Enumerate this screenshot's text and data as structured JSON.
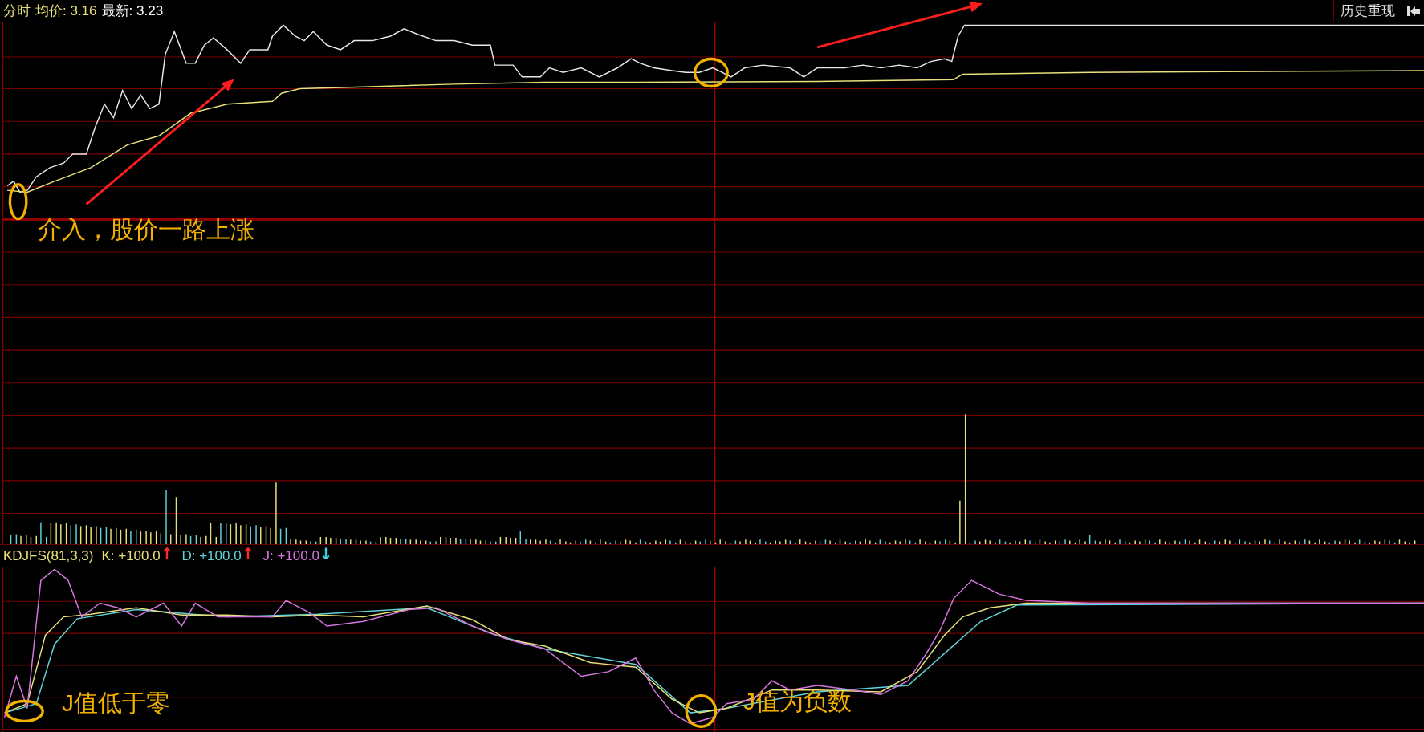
{
  "header": {
    "mode": "分时",
    "avg_label": "均价:",
    "avg": "3.16",
    "last_label": "最新:",
    "last": "3.23"
  },
  "replay_button": {
    "label": "历史重现"
  },
  "indicator": {
    "name": "KDJFS(81,3,3)",
    "values": [
      {
        "label": "K:",
        "value": "+100.0",
        "color": "#e8e07a",
        "arrow": {
          "text": "↑",
          "color": "#ff2a2a"
        }
      },
      {
        "label": "D:",
        "value": "+100.0",
        "color": "#5fd3d8",
        "arrow": {
          "text": "↑",
          "color": "#ff2a2a"
        }
      },
      {
        "label": "J:",
        "value": "+100.0",
        "color": "#d676e0",
        "arrow": {
          "text": "↓",
          "color": "#3fd0e0"
        }
      }
    ]
  },
  "annotations": [
    {
      "text": "介入，股价一路上涨"
    },
    {
      "text": "J值低于零"
    },
    {
      "text": "J值为负数"
    }
  ]
}
